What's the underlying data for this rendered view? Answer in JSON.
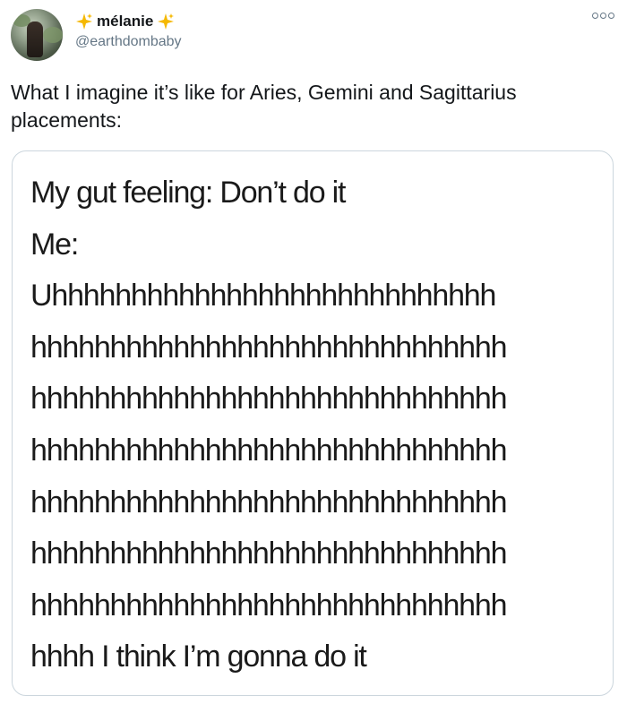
{
  "author": {
    "display_name": "mélanie",
    "handle": "@earthdombaby",
    "name_decoration_icon": "sparkles-icon"
  },
  "more_icon": "more-options-icon",
  "tweet": {
    "text_line_1": "What I imagine it’s like for Aries, Gemini and Sagittarius",
    "text_line_2": "placements:"
  },
  "meme": {
    "lines": [
      "My gut feeling: Don’t do it",
      "Me:",
      "Uhhhhhhhhhhhhhhhhhhhhhhhhhhhh",
      "hhhhhhhhhhhhhhhhhhhhhhhhhhhhhh",
      "hhhhhhhhhhhhhhhhhhhhhhhhhhhhhh",
      "hhhhhhhhhhhhhhhhhhhhhhhhhhhhhh",
      "hhhhhhhhhhhhhhhhhhhhhhhhhhhhhh",
      "hhhhhhhhhhhhhhhhhhhhhhhhhhhhhh",
      "hhhhhhhhhhhhhhhhhhhhhhhhhhhhhh",
      "hhhh I think I’m gonna do it"
    ]
  },
  "colors": {
    "sparkle": "#f5b800",
    "secondary_text": "#657786",
    "border": "#ccd6dd"
  }
}
